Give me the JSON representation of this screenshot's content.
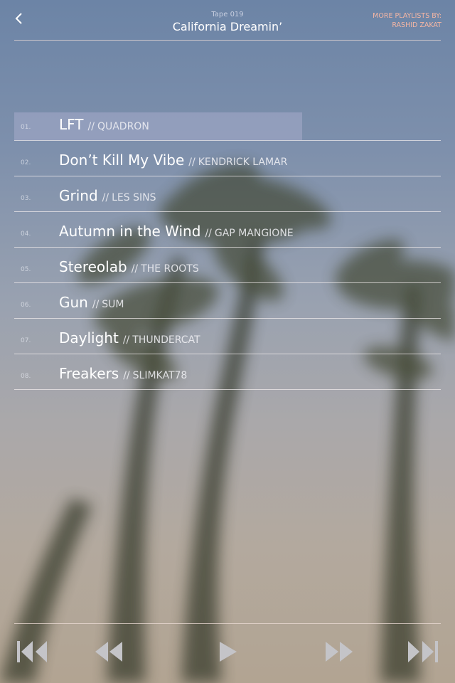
{
  "header": {
    "tape_label": "Tape 019",
    "title": "California Dreamin’",
    "more_playlists_line1": "MORE PLAYLISTS BY:",
    "more_playlists_line2": "RASHID ZAKAT",
    "back_icon": "chevron-left-icon"
  },
  "colors": {
    "accent": "#f4b6a4",
    "active_row": "#a5acca",
    "text_primary": "#ffffff"
  },
  "tracks": [
    {
      "number": "01.",
      "title": "LFT",
      "separator": "//",
      "artist": "QUADRON",
      "active": true
    },
    {
      "number": "02.",
      "title": "Don’t Kill My Vibe",
      "separator": "//",
      "artist": "KENDRICK LAMAR",
      "active": false
    },
    {
      "number": "03.",
      "title": "Grind",
      "separator": "//",
      "artist": "LES SINS",
      "active": false
    },
    {
      "number": "04.",
      "title": "Autumn in the Wind",
      "separator": "//",
      "artist": "GAP MANGIONE",
      "active": false
    },
    {
      "number": "05.",
      "title": "Stereolab",
      "separator": "//",
      "artist": "THE ROOTS",
      "active": false
    },
    {
      "number": "06.",
      "title": "Gun",
      "separator": "//",
      "artist": "SUM",
      "active": false
    },
    {
      "number": "07.",
      "title": "Daylight",
      "separator": "//",
      "artist": "THUNDERCAT",
      "active": false
    },
    {
      "number": "08.",
      "title": "Freakers",
      "separator": "//",
      "artist": "SLIMKAT78",
      "active": false
    }
  ],
  "controls": {
    "previous_track_icon": "skip-back-icon",
    "rewind_icon": "rewind-icon",
    "play_icon": "play-icon",
    "fast_forward_icon": "fast-forward-icon",
    "next_track_icon": "skip-forward-icon"
  }
}
